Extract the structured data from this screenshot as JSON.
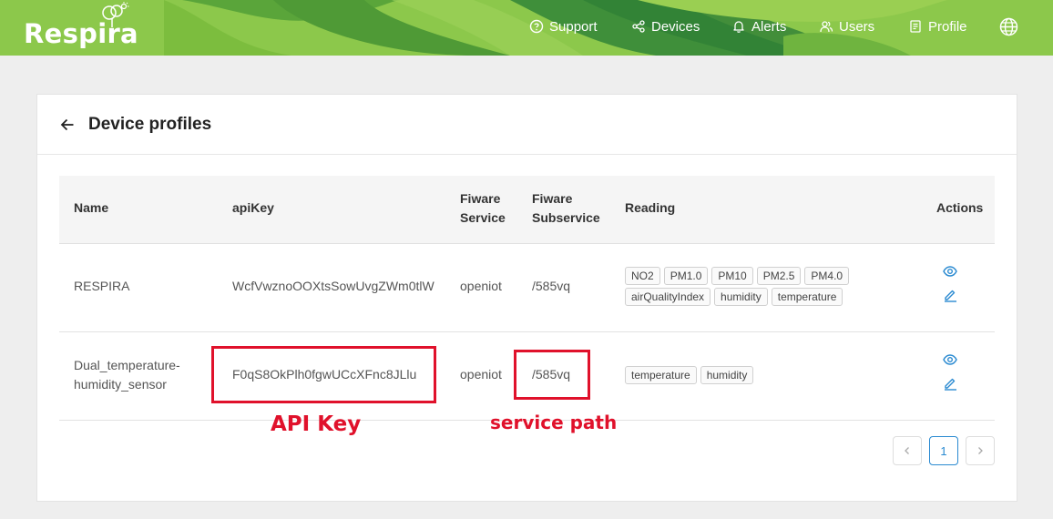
{
  "header": {
    "logo": "Respira",
    "nav": {
      "support": "Support",
      "devices": "Devices",
      "alerts": "Alerts",
      "users": "Users",
      "profile": "Profile"
    }
  },
  "page": {
    "title": "Device profiles"
  },
  "table": {
    "headers": {
      "name": "Name",
      "apikey": "apiKey",
      "service_1": "Fiware",
      "service_2": "Service",
      "subservice_1": "Fiware",
      "subservice_2": "Subservice",
      "reading": "Reading",
      "actions": "Actions"
    },
    "rows": [
      {
        "name_1": "RESPIRA",
        "apikey": "WcfVwznoOOXtsSowUvgZWm0tlW",
        "service": "openiot",
        "subservice": "/585vq",
        "readings": [
          "NO2",
          "PM1.0",
          "PM10",
          "PM2.5",
          "PM4.0",
          "airQualityIndex",
          "humidity",
          "temperature"
        ]
      },
      {
        "name_1": "Dual_temperature-",
        "name_2": "humidity_sensor",
        "apikey": "F0qS8OkPlh0fgwUCcXFnc8JLlu",
        "service": "openiot",
        "subservice": "/585vq",
        "readings": [
          "temperature",
          "humidity"
        ]
      }
    ]
  },
  "pagination": {
    "current": "1"
  },
  "annotations": {
    "api_key": "API Key",
    "service_path": "service path",
    "color": "#e0112b"
  },
  "colors": {
    "brand_green": "#84c441",
    "link_blue": "#2a8ad1"
  }
}
